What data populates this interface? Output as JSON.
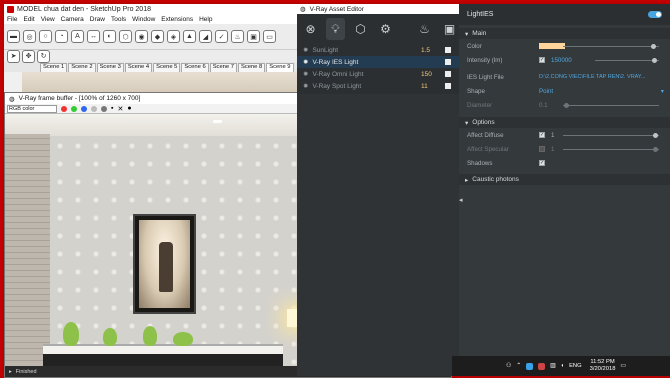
{
  "sketchup": {
    "title": "MODEL chua dat den - SketchUp Pro 2018",
    "menu": [
      "File",
      "Edit",
      "View",
      "Camera",
      "Draw",
      "Tools",
      "Window",
      "Extensions",
      "Help"
    ],
    "scenes": [
      "Scene 1",
      "Scene 2",
      "Scene 3",
      "Scene 4",
      "Scene 5",
      "Scene 6",
      "Scene 7",
      "Scene 8",
      "Scene 9"
    ],
    "active_scene": "Scene 9"
  },
  "vfb": {
    "title": "V-Ray frame buffer - [100% of 1260 x 700]",
    "channel": "RGB color",
    "status": "Finished"
  },
  "asset_editor": {
    "title": "V-Ray Asset Editor",
    "lights": [
      {
        "name": "SunLight",
        "value": "1.5"
      },
      {
        "name": "V-Ray IES Light",
        "value": ""
      },
      {
        "name": "V-Ray Omni Light",
        "value": "150"
      },
      {
        "name": "V-Ray Spot Light",
        "value": "11"
      }
    ],
    "selected_light": "LightIES",
    "main_section": "Main",
    "color_label": "Color",
    "color_value": "#ffd59b",
    "intensity_label": "Intensity (lm)",
    "intensity_value": "150000",
    "ies_label": "IES Light File",
    "ies_value": "D:\\2.CONG VIEC\\FILE TAP REN\\2. VRAY...",
    "shape_label": "Shape",
    "shape_value": "Point",
    "diameter_label": "Diameter",
    "diameter_value": "0.1",
    "options_section": "Options",
    "affect_diffuse_label": "Affect Diffuse",
    "affect_diffuse_value": "1",
    "affect_specular_label": "Affect Specular",
    "affect_specular_value": "1",
    "shadows_label": "Shadows",
    "caustic_section": "Caustic photons"
  },
  "taskbar": {
    "lang": "ENG",
    "time": "11:52 PM",
    "date": "3/20/2018"
  }
}
